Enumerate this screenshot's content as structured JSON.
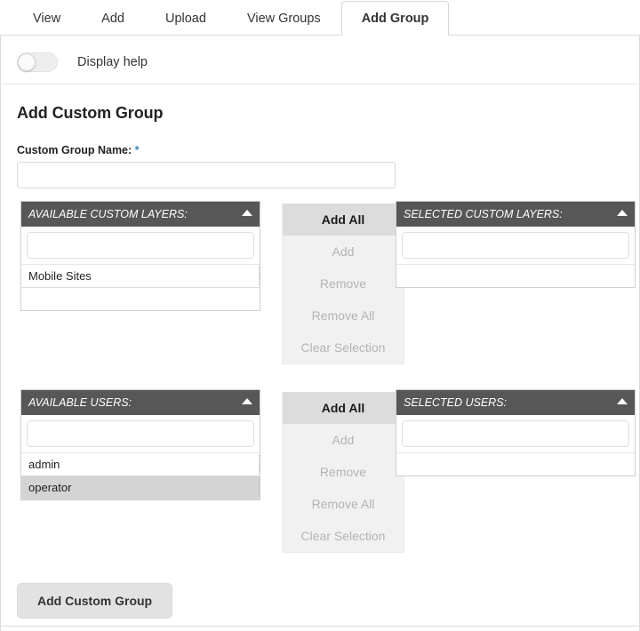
{
  "tabs": [
    {
      "label": "View",
      "active": false
    },
    {
      "label": "Add",
      "active": false
    },
    {
      "label": "Upload",
      "active": false
    },
    {
      "label": "View Groups",
      "active": false
    },
    {
      "label": "Add Group",
      "active": true
    }
  ],
  "help": {
    "label": "Display help",
    "enabled": false
  },
  "form": {
    "title": "Add Custom Group",
    "name_label": "Custom Group Name:",
    "required_marker": "*",
    "name_value": "",
    "name_placeholder": "",
    "submit_label": "Add Custom Group"
  },
  "layers_picklist": {
    "available": {
      "title": "AVAILABLE CUSTOM LAYERS:",
      "filter_value": "",
      "filter_placeholder": "",
      "items": [
        {
          "label": "Mobile Sites",
          "selected": false
        }
      ]
    },
    "selected": {
      "title": "SELECTED CUSTOM LAYERS:",
      "filter_value": "",
      "filter_placeholder": "",
      "items": []
    },
    "buttons": [
      {
        "label": "Add All",
        "enabled": true
      },
      {
        "label": "Add",
        "enabled": false
      },
      {
        "label": "Remove",
        "enabled": false
      },
      {
        "label": "Remove All",
        "enabled": false
      },
      {
        "label": "Clear Selection",
        "enabled": false
      }
    ]
  },
  "users_picklist": {
    "available": {
      "title": "AVAILABLE USERS:",
      "filter_value": "",
      "filter_placeholder": "",
      "items": [
        {
          "label": "admin",
          "selected": false
        },
        {
          "label": "operator",
          "selected": true
        }
      ]
    },
    "selected": {
      "title": "SELECTED USERS:",
      "filter_value": "",
      "filter_placeholder": "",
      "items": []
    },
    "buttons": [
      {
        "label": "Add All",
        "enabled": true
      },
      {
        "label": "Add",
        "enabled": false
      },
      {
        "label": "Remove",
        "enabled": false
      },
      {
        "label": "Remove All",
        "enabled": false
      },
      {
        "label": "Clear Selection",
        "enabled": false
      }
    ]
  },
  "colors": {
    "panel_header_bg": "#575757",
    "enabled_button_bg": "#dcdcdc",
    "disabled_text": "#b4b4b4",
    "selected_row_bg": "#d4d4d4",
    "required_marker": "#3b82c4"
  }
}
